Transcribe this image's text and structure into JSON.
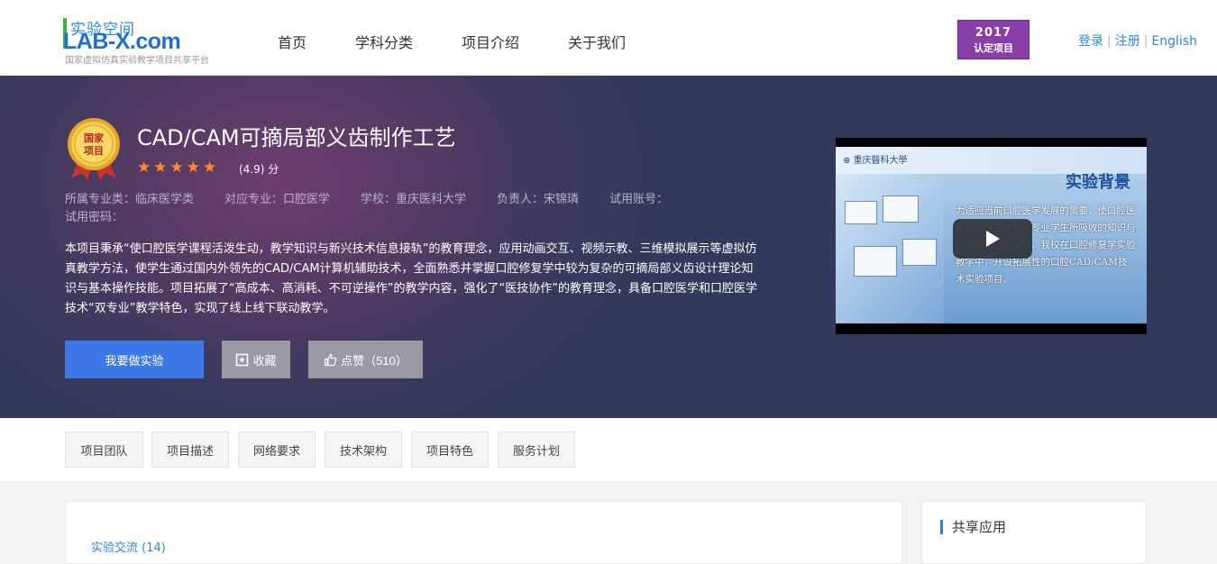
{
  "header": {
    "logo_cn": "实验空间",
    "logo_en": "LAB-X.com",
    "logo_sub": "国家虚拟仿真实验教学项目共享平台",
    "nav": [
      "首页",
      "学科分类",
      "项目介绍",
      "关于我们"
    ],
    "badge_year": "2017",
    "badge_text": "认定项目",
    "login": "登录",
    "register": "注册",
    "english": "English"
  },
  "hero": {
    "medal_text": "国家项目",
    "title": "CAD/CAM可摘局部义齿制作工艺",
    "rating": 4.9,
    "rating_stars": "★★★★★",
    "score_label": "(4.9) 分",
    "meta": {
      "major_category": "所属专业类：临床医学类",
      "major": "对应专业：口腔医学",
      "school": "学校：重庆医科大学",
      "owner": "负责人：宋锦璘",
      "trial_account": "试用账号：",
      "trial_password": "试用密码："
    },
    "description": "本项目秉承“使口腔医学课程活泼生动，教学知识与新兴技术信息接轨”的教育理念，应用动画交互、视频示教、三维模拟展示等虚拟仿真教学方法，使学生通过国内外领先的CAD/CAM计算机辅助技术，全面熟悉并掌握口腔修复学中较为复杂的可摘局部义齿设计理论知识与基本操作技能。项目拓展了“高成本、高消耗、不可逆操作”的教学内容，强化了“医技协作”的教育理念，具备口腔医学和口腔医学技术“双专业”教学特色，实现了线上线下联动教学。",
    "btn_experiment": "我要做实验",
    "btn_favorite": "收藏",
    "btn_like": "点赞（510）"
  },
  "video": {
    "school": "重庆醫科大學",
    "slide_title": "实验背景",
    "slide_text": "为适应当前口腔医学发展的需要，使口腔医学和口腔医学技术专业学生所吸收的知识与新兴技术信息接轨，我校在口腔修复学实验教学中，开设拓展性的口腔CAD/CAM技术实验项目。"
  },
  "tabs": [
    "项目团队",
    "项目描述",
    "网络要求",
    "技术架构",
    "项目特色",
    "服务计划"
  ],
  "content": {
    "exchange_link": "实验交流 (14)",
    "side_title": "共享应用"
  },
  "colors": {
    "accent_blue": "#3c78e6",
    "link_blue": "#2c88d8",
    "star_orange": "#ff8a2a",
    "badge_purple": "#8a3fa8"
  }
}
